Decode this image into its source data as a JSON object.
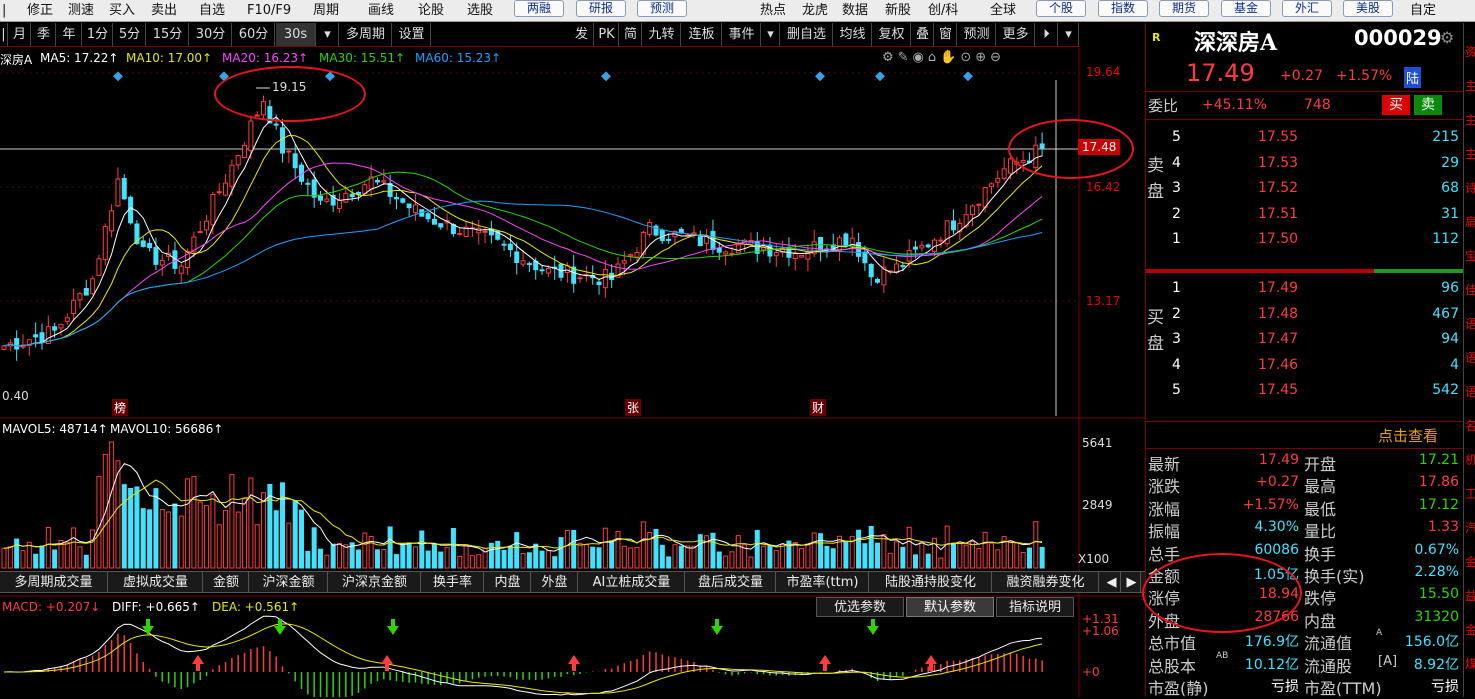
{
  "top_menu": {
    "items": [
      "修正",
      "测速",
      "买入",
      "卖出",
      "自选",
      "F10/F9",
      "周期",
      "画线",
      "论股",
      "选股"
    ],
    "boxed_left": [
      "两融",
      "研报",
      "预测"
    ],
    "right_items": [
      "热点",
      "龙虎",
      "数据",
      "新股",
      "创/科",
      "全球"
    ],
    "boxed_right": [
      "个股",
      "指数",
      "期货",
      "基金",
      "外汇",
      "美股"
    ],
    "last": "自定"
  },
  "period_bar": {
    "items": [
      "月",
      "季",
      "年",
      "1分",
      "5分",
      "15分",
      "30分",
      "60分",
      "30s",
      "▾",
      "多周期",
      "设置"
    ],
    "right_items": [
      "发",
      "PK",
      "简",
      "九转",
      "连板",
      "事件",
      "▾",
      "删自选",
      "均线",
      "复权",
      "叠",
      "窗",
      "预测",
      "更多",
      "⏵",
      "▾"
    ]
  },
  "chart_header": {
    "name": "深房A",
    "ma5": "MA5: 17.22↑",
    "ma10": "MA10: 17.00↑",
    "ma20": "MA20: 16.23↑",
    "ma30": "MA30: 15.51↑",
    "ma60": "MA60: 15.23↑"
  },
  "price_axis": {
    "labels": [
      "19.64",
      "17.48",
      "16.42",
      "13.17"
    ]
  },
  "annotations": {
    "high_label": "19.15",
    "low_label": "0.40",
    "markers": [
      "榜",
      "张",
      "财"
    ]
  },
  "volume_header": {
    "mavol5": "MAVOL5: 48714↑",
    "mavol10": "MAVOL10: 56686↑"
  },
  "volume_axis": {
    "labels": [
      "5641",
      "2849",
      "X100"
    ]
  },
  "indicator_tabs": [
    "多周期成交量",
    "虚拟成交量",
    "金额",
    "沪深金额",
    "沪深京金额",
    "换手率",
    "内盘",
    "外盘",
    "AI立桩成交量",
    "盘后成交量",
    "市盈率(ttm)",
    "陆股通持股变化",
    "融资融券变化"
  ],
  "macd_header": {
    "macd": "MACD: +0.207↓",
    "diff": "DIFF: +0.665↑",
    "dea": "DEA: +0.561↑"
  },
  "param_buttons": [
    "优选参数",
    "默认参数",
    "指标说明"
  ],
  "macd_axis": {
    "labels": [
      "+1.31",
      "+1.06",
      "+0"
    ]
  },
  "stock": {
    "badge": "R",
    "name": "深深房A",
    "code": "000029",
    "price": "17.49",
    "change": "+0.27",
    "pct": "+1.57%",
    "tag": "陆"
  },
  "order_ratio": {
    "label": "委比",
    "value": "+45.11%",
    "diff": "748",
    "buy": "买",
    "sell": "卖"
  },
  "sell_book": {
    "label": "卖盘",
    "rows": [
      {
        "level": "5",
        "price": "17.55",
        "vol": "215"
      },
      {
        "level": "4",
        "price": "17.53",
        "vol": "29"
      },
      {
        "level": "3",
        "price": "17.52",
        "vol": "68"
      },
      {
        "level": "2",
        "price": "17.51",
        "vol": "31"
      },
      {
        "level": "1",
        "price": "17.50",
        "vol": "112"
      }
    ]
  },
  "buy_book": {
    "label": "买盘",
    "rows": [
      {
        "level": "1",
        "price": "17.49",
        "vol": "96"
      },
      {
        "level": "2",
        "price": "17.48",
        "vol": "467"
      },
      {
        "level": "3",
        "price": "17.47",
        "vol": "94"
      },
      {
        "level": "4",
        "price": "17.46",
        "vol": "4"
      },
      {
        "level": "5",
        "price": "17.45",
        "vol": "542"
      }
    ]
  },
  "click_view": "点击查看",
  "stats": [
    {
      "l1": "最新",
      "v1": "17.49",
      "c1": "red",
      "l2": "开盘",
      "v2": "17.21",
      "c2": "grn"
    },
    {
      "l1": "涨跌",
      "v1": "+0.27",
      "c1": "red",
      "l2": "最高",
      "v2": "17.86",
      "c2": "red"
    },
    {
      "l1": "涨幅",
      "v1": "+1.57%",
      "c1": "red",
      "l2": "最低",
      "v2": "17.12",
      "c2": "grn"
    },
    {
      "l1": "振幅",
      "v1": "4.30%",
      "c1": "cyn",
      "l2": "量比",
      "v2": "1.33",
      "c2": "red"
    },
    {
      "l1": "总手",
      "v1": "60086",
      "c1": "cyn",
      "l2": "换手",
      "v2": "0.67%",
      "c2": "cyn"
    },
    {
      "l1": "金额",
      "v1": "1.05亿",
      "c1": "cyn",
      "l2": "换手(实)",
      "v2": "2.28%",
      "c2": "cyn"
    },
    {
      "l1": "涨停",
      "v1": "18.94",
      "c1": "red",
      "l2": "跌停",
      "v2": "15.50",
      "c2": "grn"
    },
    {
      "l1": "外盘",
      "v1": "28766",
      "c1": "red",
      "l2": "内盘",
      "v2": "31320",
      "c2": "grn"
    },
    {
      "l1": "总市值",
      "v1": "176.9亿",
      "c1": "cyn",
      "l2": "流通值",
      "v2": "156.0亿",
      "c2": "cyn"
    },
    {
      "l1": "总股本",
      "v1": "10.12亿",
      "c1": "cyn",
      "l2": "流通股",
      "v2": "8.92亿",
      "c2": "cyn"
    },
    {
      "l1": "市盈(静)",
      "v1": "亏损",
      "c1": "wht",
      "l2": "市盈(TTM)",
      "v2": "亏损",
      "c2": "wht"
    }
  ],
  "stats_sup": {
    "row8": "A",
    "row9": "AB",
    "row9b": "[A]"
  },
  "side_strip": [
    "资",
    "主",
    "主",
    "主",
    "诗",
    "扁",
    "宝",
    "佳",
    "语",
    "语",
    "语",
    "名",
    "机",
    "工",
    "汽",
    "金",
    "益",
    "金",
    "煤"
  ],
  "colors": {
    "up": "#ff3b3b",
    "down": "#3fe3ff",
    "ma5": "#ffffff",
    "ma10": "#e8e800",
    "ma20": "#ff44ff",
    "ma30": "#2dd400",
    "ma60": "#20a0ff",
    "highlight": "#e8151b"
  }
}
